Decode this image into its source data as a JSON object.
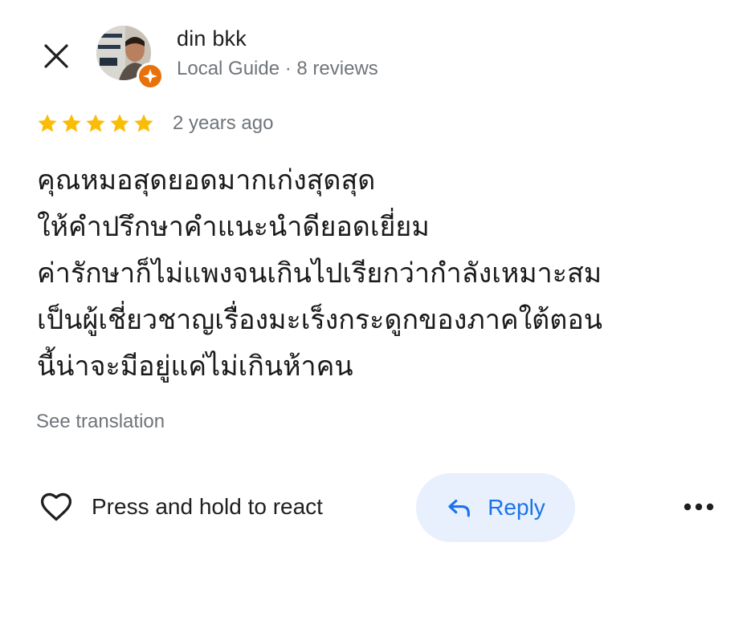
{
  "header": {
    "close_icon": "close-icon",
    "avatar_icon": "avatar-photo",
    "badge_icon": "local-guide-badge-icon",
    "user_name": "din bkk",
    "user_meta": "Local Guide · 8 reviews"
  },
  "rating": {
    "stars": 5,
    "star_color": "#fbbc04",
    "date": "2 years ago"
  },
  "review": {
    "text": "คุณหมอสุดยอดมากเก่งสุดสุด\nให้คำปรึกษาคำแนะนำดียอดเยี่ยม\nค่ารักษาก็ไม่แพงจนเกินไปเรียกว่ากำลังเหมาะสม\nเป็นผู้เชี่ยวชาญเรื่องมะเร็งกระดูกของภาคใต้ตอน\nนี้น่าจะมีอยู่แค่ไม่เกินห้าคน",
    "see_translation": "See translation"
  },
  "actions": {
    "react_icon": "heart-outline-icon",
    "react_label": "Press and hold to react",
    "reply_icon": "reply-arrow-icon",
    "reply_label": "Reply",
    "more_icon": "more-horizontal-icon"
  },
  "colors": {
    "accent": "#1a73e8",
    "reply_bg": "#e8f0fe",
    "badge": "#e8710a",
    "secondary_text": "#70757a"
  }
}
